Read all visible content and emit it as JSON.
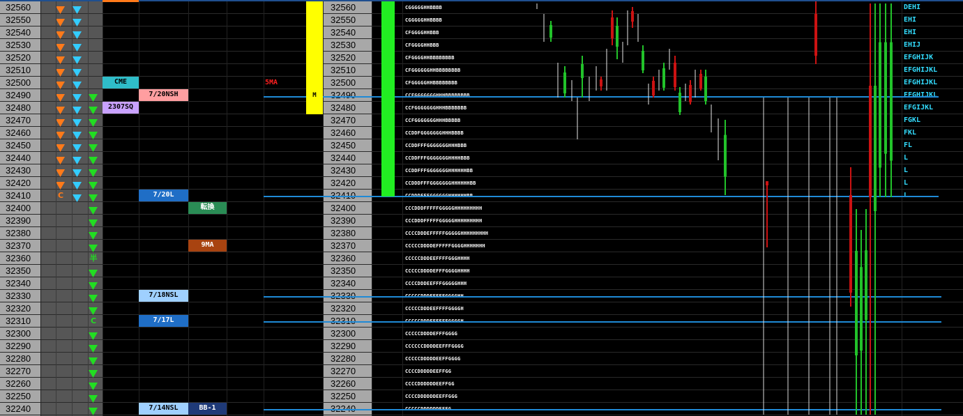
{
  "prices": [
    "32560",
    "32550",
    "32540",
    "32530",
    "32520",
    "32510",
    "32500",
    "32490",
    "32480",
    "32470",
    "32460",
    "32450",
    "32440",
    "32430",
    "32420",
    "32410",
    "32400",
    "32390",
    "32380",
    "32370",
    "32360",
    "32350",
    "32340",
    "32330",
    "32320",
    "32310",
    "32300",
    "32290",
    "32280",
    "32270",
    "32260",
    "32250",
    "32240"
  ],
  "signals": [
    {
      "orange": "down",
      "cyan": "down",
      "green": ""
    },
    {
      "orange": "down",
      "cyan": "down",
      "green": ""
    },
    {
      "orange": "down",
      "cyan": "down",
      "green": ""
    },
    {
      "orange": "down",
      "cyan": "down",
      "green": ""
    },
    {
      "orange": "down",
      "cyan": "down",
      "green": ""
    },
    {
      "orange": "down",
      "cyan": "down",
      "green": ""
    },
    {
      "orange": "down",
      "cyan": "down",
      "green": ""
    },
    {
      "orange": "down",
      "cyan": "down",
      "green": "down"
    },
    {
      "orange": "down",
      "cyan": "down",
      "green": "down"
    },
    {
      "orange": "down",
      "cyan": "down",
      "green": "down"
    },
    {
      "orange": "down",
      "cyan": "down",
      "green": "down"
    },
    {
      "orange": "down",
      "cyan": "down",
      "green": "down"
    },
    {
      "orange": "down",
      "cyan": "down",
      "green": "down"
    },
    {
      "orange": "down",
      "cyan": "down",
      "green": "down"
    },
    {
      "orange": "down",
      "cyan": "down",
      "green": "down"
    },
    {
      "orange": "C",
      "cyan": "down",
      "green": "down"
    },
    {
      "orange": "",
      "cyan": "",
      "green": "down"
    },
    {
      "orange": "",
      "cyan": "",
      "green": "down"
    },
    {
      "orange": "",
      "cyan": "",
      "green": "down"
    },
    {
      "orange": "",
      "cyan": "",
      "green": "down"
    },
    {
      "orange": "",
      "cyan": "",
      "green": "半"
    },
    {
      "orange": "",
      "cyan": "",
      "green": "down"
    },
    {
      "orange": "",
      "cyan": "",
      "green": "down"
    },
    {
      "orange": "",
      "cyan": "",
      "green": "down"
    },
    {
      "orange": "",
      "cyan": "",
      "green": "down"
    },
    {
      "orange": "",
      "cyan": "",
      "green": "C"
    },
    {
      "orange": "",
      "cyan": "",
      "green": "down"
    },
    {
      "orange": "",
      "cyan": "",
      "green": "down"
    },
    {
      "orange": "",
      "cyan": "",
      "green": "down"
    },
    {
      "orange": "",
      "cyan": "",
      "green": "down"
    },
    {
      "orange": "",
      "cyan": "",
      "green": "down"
    },
    {
      "orange": "",
      "cyan": "",
      "green": "down"
    },
    {
      "orange": "",
      "cyan": "",
      "green": "down"
    }
  ],
  "labels": {
    "cme": "CME",
    "sq": "2307SQ",
    "nsh_720": "7/20NSH",
    "l_720": "7/20L",
    "tenkan": "転換",
    "ma9": "9MA",
    "nsl_718": "7/18NSL",
    "l_717": "7/17L",
    "nsl_714": "7/14NSL",
    "bb": "BB-1",
    "ma5": "5MA",
    "m_marker": "M"
  },
  "tpo": [
    "CGGGGGHHBBBB",
    "CGGGGGHHBBBB",
    "CFGGGGHHBBB",
    "CFGGGGHHBBB",
    "CFGGGGHHBBBBBBBB",
    "CFGGGGGGHHBBBBBBBB",
    "CFGGGGGHHBBBBBBBB",
    "CCFGGGGGGGHHHBBBBBBBB",
    "CCFGGGGGGGHHHBBBBBBB",
    "CCFGGGGGGGHHHBBBBB",
    "CCDDFGGGGGGGHHHBBBB",
    "CCDDFFFGGGGGGGHHHBBB",
    "CCDDFFFGGGGGGGHHHHBBB",
    "CCDDFFFGGGGGGGHHHHHHBB",
    "CCDDDFFFGGGGGGGHHHHHHBB",
    "CCDDDFFFGGGGGGHHHHHHBB",
    "CCCDDDFFFFFGGGGGHHHHHHHHH",
    "CCCDDDFFFFFGGGGGHHHHHHHHH",
    "CCCCDDDEFFFFFGGGGGHHHHHHHHH",
    "CCCCCDDDDEFFFFFGGGGHHHHHHH",
    "CCCCCDDDEEFFFFGGGHHHH",
    "CCCCCDDDDEFFFGGGGHHHH",
    "CCCCDDDEEFFFGGGGGHHH",
    "CCCCCDDDEEFFFGGGGHH",
    "CCCCCDDDEEFFFFGGGGH",
    "CCCCCDDDEEFFFFGGGGH",
    "CCCCCDDDDEFFFGGGG",
    "CCCCCCDDDDEEFFFGGGG",
    "CCCCCDDDDDEEFFGGGG",
    "CCCCDDDDDEEFFGG",
    "CCCCDDDDDDEEFFGG",
    "CCCCDDDDDDEEFFGGG",
    "CCCCCDDDDDDEFFG"
  ],
  "side": [
    "DEHI",
    "EHI",
    "EHI",
    "EHIJ",
    "EFGHIJK",
    "EFGHIJKL",
    "EFGHIJKL",
    "EFGHIJKL",
    "EFGIJKL",
    "FGKL",
    "FKL",
    "FL",
    "L",
    "L",
    "L",
    "L"
  ],
  "colors": {
    "grid": "#1a1a1a",
    "price_bg": "#a8a8a8",
    "panel_bg": "#565656",
    "hline": "#1f8ad6",
    "up": "#22c22a",
    "down": "#cc1212",
    "volume_yellow": "#ffff00",
    "volume_green": "#22ee22"
  }
}
